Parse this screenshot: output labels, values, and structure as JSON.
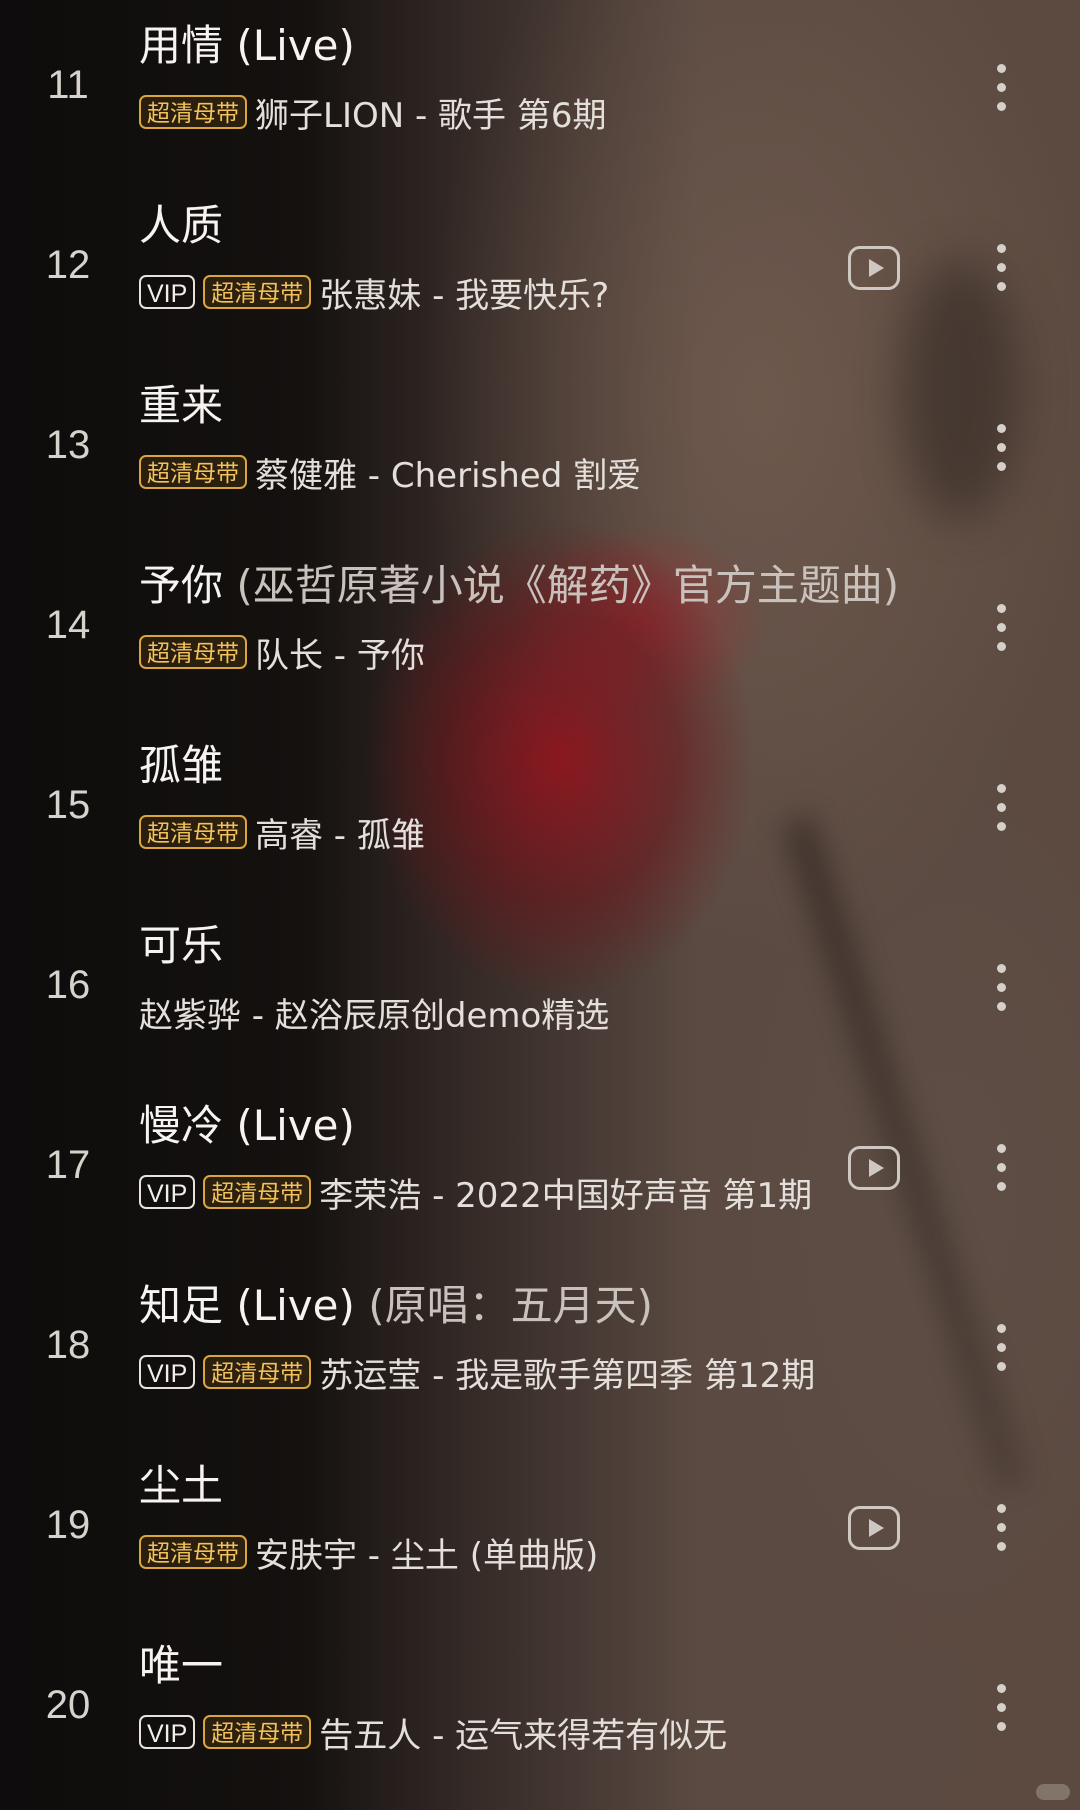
{
  "songs": [
    {
      "num": "11",
      "title": "用情 (Live)",
      "title_sub": "",
      "vip": false,
      "hq": true,
      "artist": "狮子LION - 歌手 第6期",
      "mv": false
    },
    {
      "num": "12",
      "title": "人质",
      "title_sub": "",
      "vip": true,
      "hq": true,
      "artist": "张惠妹 - 我要快乐?",
      "mv": true
    },
    {
      "num": "13",
      "title": "重来",
      "title_sub": "",
      "vip": false,
      "hq": true,
      "artist": "蔡健雅 - Cherished 割爱",
      "mv": false
    },
    {
      "num": "14",
      "title": "予你",
      "title_sub": " (巫哲原著小说《解药》官方主题曲)",
      "vip": false,
      "hq": true,
      "artist": "队长 - 予你",
      "mv": false
    },
    {
      "num": "15",
      "title": "孤雏",
      "title_sub": "",
      "vip": false,
      "hq": true,
      "artist": "高睿 - 孤雏",
      "mv": false
    },
    {
      "num": "16",
      "title": "可乐",
      "title_sub": "",
      "vip": false,
      "hq": false,
      "artist": "赵紫骅 - 赵浴辰原创demo精选",
      "mv": false
    },
    {
      "num": "17",
      "title": "慢冷 (Live)",
      "title_sub": "",
      "vip": true,
      "hq": true,
      "artist": "李荣浩 - 2022中国好声音 第1期",
      "mv": true
    },
    {
      "num": "18",
      "title": "知足 (Live)",
      "title_sub": " (原唱：五月天)",
      "vip": true,
      "hq": true,
      "artist": "苏运莹 - 我是歌手第四季 第12期",
      "mv": false
    },
    {
      "num": "19",
      "title": "尘土",
      "title_sub": "",
      "vip": false,
      "hq": true,
      "artist": "安肤宇 - 尘土 (单曲版)",
      "mv": true
    },
    {
      "num": "20",
      "title": "唯一",
      "title_sub": "",
      "vip": true,
      "hq": true,
      "artist": "告五人 - 运气来得若有似无",
      "mv": false
    }
  ],
  "badges": {
    "vip_label": "VIP",
    "hq_label": "超清母带"
  },
  "icons": {
    "mv": "play-video-icon",
    "more": "more-vertical-icon"
  },
  "colors": {
    "hq_badge": "#f3c25a",
    "text_primary": "#f6f3f0",
    "text_secondary": "#c9c2bc"
  }
}
